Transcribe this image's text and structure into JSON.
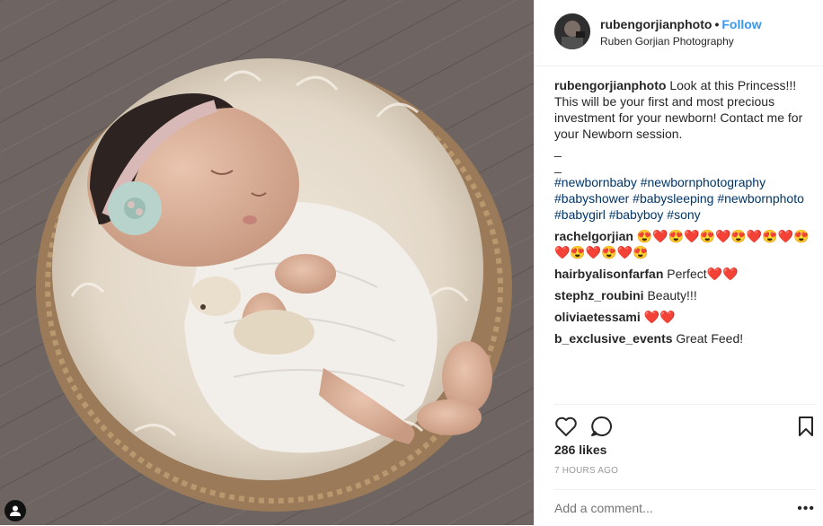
{
  "author": {
    "username": "rubengorjianphoto",
    "separator": "•",
    "follow_label": "Follow",
    "location": "Ruben Gorjian Photography"
  },
  "caption": {
    "username": "rubengorjianphoto",
    "text": "Look at this Princess!!! This will be your first and most precious investment for your newborn! Contact me for your Newborn session.",
    "dash1": "_",
    "dash2": "_",
    "hashtags": "#newbornbaby #newbornphotography #babyshower #babysleeping #newbornphoto #babygirl #babyboy #sony"
  },
  "comments": [
    {
      "user": "rachelgorjian",
      "text": "😍❤️😍❤️😍❤️😍❤️😍❤️😍❤️😍❤️😍❤️😍"
    },
    {
      "user": "hairbyalisonfarfan",
      "text": "Perfect❤️❤️"
    },
    {
      "user": "stephz_roubini",
      "text": "Beauty!!!"
    },
    {
      "user": "oliviaetessami",
      "text": "❤️❤️"
    },
    {
      "user": "b_exclusive_events",
      "text": "Great Feed!"
    }
  ],
  "likes": "286 likes",
  "time_ago": "7 HOURS AGO",
  "add_comment_placeholder": "Add a comment...",
  "more_glyph": "•••",
  "icons": [
    "heart-icon",
    "comment-icon",
    "bookmark-icon",
    "user-tag-icon",
    "ellipsis-icon"
  ],
  "colors": {
    "link": "#3897f0",
    "hashtag": "#003569",
    "muted": "#999999",
    "text": "#262626"
  }
}
